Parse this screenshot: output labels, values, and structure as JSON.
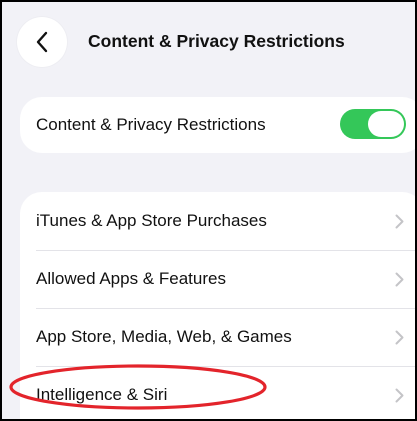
{
  "header": {
    "title": "Content & Privacy Restrictions",
    "back_icon": "chevron-left-icon"
  },
  "toggle": {
    "label": "Content & Privacy Restrictions",
    "state": "on",
    "on_color": "#34c759"
  },
  "menu": {
    "items": [
      {
        "label": "iTunes & App Store Purchases",
        "icon": "chevron-right-icon"
      },
      {
        "label": "Allowed Apps & Features",
        "icon": "chevron-right-icon"
      },
      {
        "label": "App Store, Media, Web, & Games",
        "icon": "chevron-right-icon"
      },
      {
        "label": "Intelligence & Siri",
        "icon": "chevron-right-icon"
      }
    ]
  },
  "annotation": {
    "shape": "ellipse",
    "color": "#e3242b",
    "highlights": "Intelligence & Siri"
  },
  "colors": {
    "background": "#f2f2f7",
    "card": "#ffffff",
    "chevron": "#c4c4c7"
  }
}
